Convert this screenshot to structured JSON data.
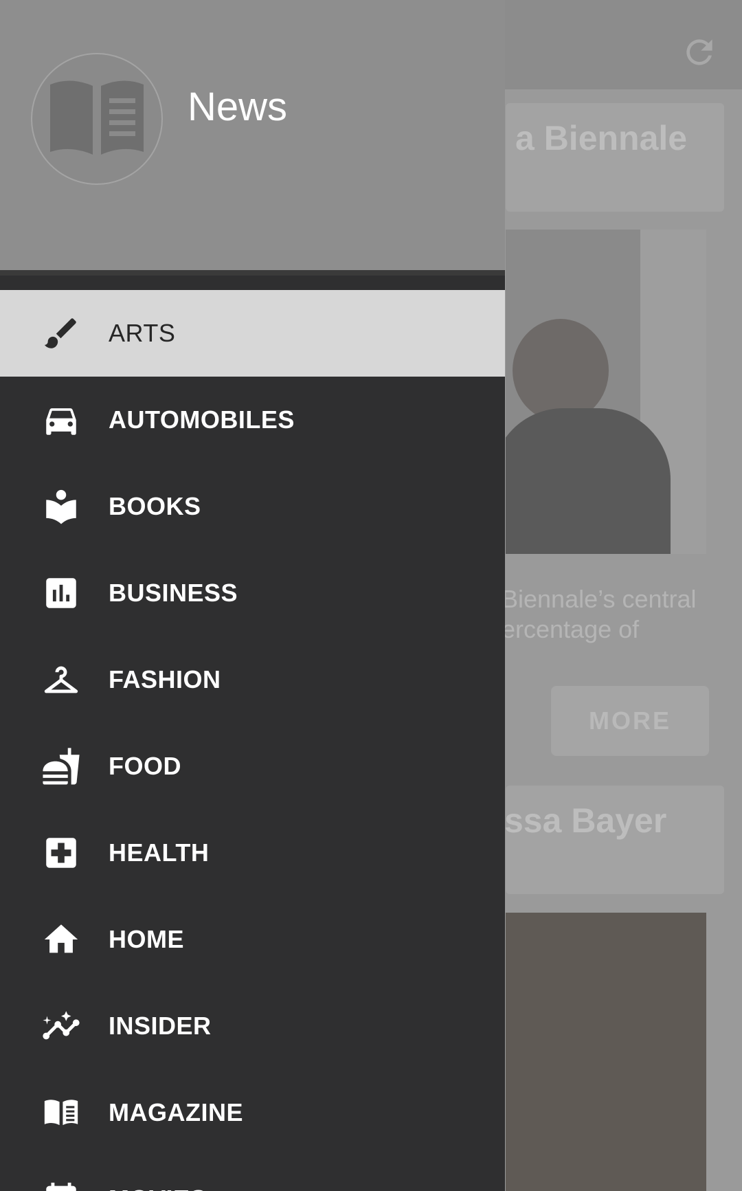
{
  "app": {
    "title": "News"
  },
  "background": {
    "card1_title": "a Biennale",
    "card1_text_line1": "Biennale’s central",
    "card1_text_line2": "ercentage of",
    "more_label": "MORE",
    "card2_title": "ssa Bayer"
  },
  "drawer": {
    "items": [
      {
        "label": "ARTS",
        "icon": "brush-icon",
        "selected": true
      },
      {
        "label": "AUTOMOBILES",
        "icon": "car-icon",
        "selected": false
      },
      {
        "label": "BOOKS",
        "icon": "reader-icon",
        "selected": false
      },
      {
        "label": "BUSINESS",
        "icon": "bar-chart-icon",
        "selected": false
      },
      {
        "label": "FASHION",
        "icon": "hanger-icon",
        "selected": false
      },
      {
        "label": "FOOD",
        "icon": "fastfood-icon",
        "selected": false
      },
      {
        "label": "HEALTH",
        "icon": "medical-cross-icon",
        "selected": false
      },
      {
        "label": "HOME",
        "icon": "home-icon",
        "selected": false
      },
      {
        "label": "INSIDER",
        "icon": "insights-icon",
        "selected": false
      },
      {
        "label": "MAGAZINE",
        "icon": "magazine-icon",
        "selected": false
      },
      {
        "label": "MOVIES",
        "icon": "calendar-icon",
        "selected": false
      }
    ]
  },
  "colors": {
    "drawer_bg": "#2f2f30",
    "selected_bg": "#d7d7d7",
    "scrim": "#8f8f8f"
  }
}
